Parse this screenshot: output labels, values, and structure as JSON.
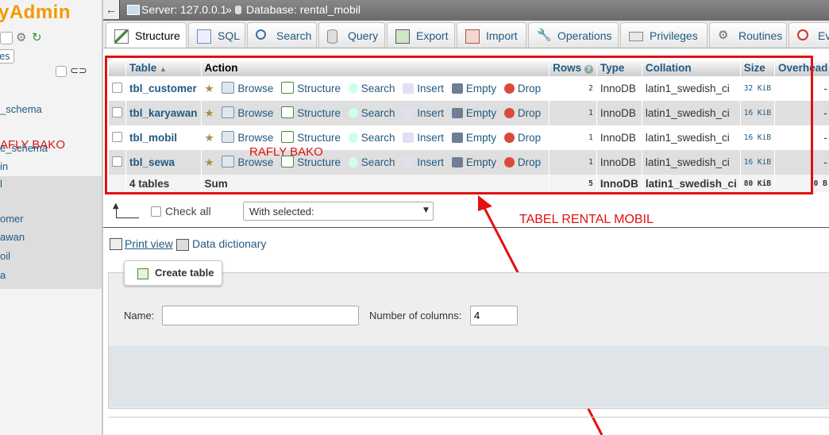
{
  "sidebar": {
    "logo": "yAdmin",
    "items": [
      "es",
      "_schema",
      "AFLY BAKO",
      "e_schema",
      "in",
      "l",
      "omer",
      "awan",
      "oil",
      "a"
    ]
  },
  "topbar": {
    "back": "←",
    "server": "Server: 127.0.0.1",
    "sep": "»",
    "database": "Database: rental_mobil"
  },
  "tabs": [
    {
      "label": "Structure",
      "icon": "structure-icon"
    },
    {
      "label": "SQL",
      "icon": "sql-icon"
    },
    {
      "label": "Search",
      "icon": "search-icon"
    },
    {
      "label": "Query",
      "icon": "query-icon"
    },
    {
      "label": "Export",
      "icon": "export-icon"
    },
    {
      "label": "Import",
      "icon": "import-icon"
    },
    {
      "label": "Operations",
      "icon": "wrench-icon"
    },
    {
      "label": "Privileges",
      "icon": "privileges-icon"
    },
    {
      "label": "Routines",
      "icon": "routines-icon"
    },
    {
      "label": "Ev",
      "icon": "events-icon"
    }
  ],
  "table": {
    "headers": {
      "table": "Table",
      "action": "Action",
      "rows": "Rows",
      "type": "Type",
      "collation": "Collation",
      "size": "Size",
      "overhead": "Overhead"
    },
    "actions": {
      "browse": "Browse",
      "structure": "Structure",
      "search": "Search",
      "insert": "Insert",
      "empty": "Empty",
      "drop": "Drop"
    },
    "rows": [
      {
        "name": "tbl_customer",
        "rows": "2",
        "type": "InnoDB",
        "collation": "latin1_swedish_ci",
        "size": "32 KiB",
        "overhead": "-"
      },
      {
        "name": "tbl_karyawan",
        "rows": "1",
        "type": "InnoDB",
        "collation": "latin1_swedish_ci",
        "size": "16 KiB",
        "overhead": "-"
      },
      {
        "name": "tbl_mobil",
        "rows": "1",
        "type": "InnoDB",
        "collation": "latin1_swedish_ci",
        "size": "16 KiB",
        "overhead": "-"
      },
      {
        "name": "tbl_sewa",
        "rows": "1",
        "type": "InnoDB",
        "collation": "latin1_swedish_ci",
        "size": "16 KiB",
        "overhead": "-"
      }
    ],
    "footer": {
      "count": "4 tables",
      "sum": "Sum",
      "rows": "5",
      "type": "InnoDB",
      "collation": "latin1_swedish_ci",
      "size": "80 KiB",
      "overhead": "0 B"
    }
  },
  "annotations": {
    "watermark": "RAFLY BAKO",
    "label": "TABEL RENTAL MOBIL",
    "color": "#e21010"
  },
  "bulk": {
    "check_all": "Check all",
    "with_selected": "With selected:"
  },
  "links": {
    "print_view": "Print view",
    "data_dictionary": "Data dictionary"
  },
  "create": {
    "button": "Create table",
    "name_label": "Name:",
    "name_value": "",
    "columns_label": "Number of columns:",
    "columns_value": "4"
  }
}
